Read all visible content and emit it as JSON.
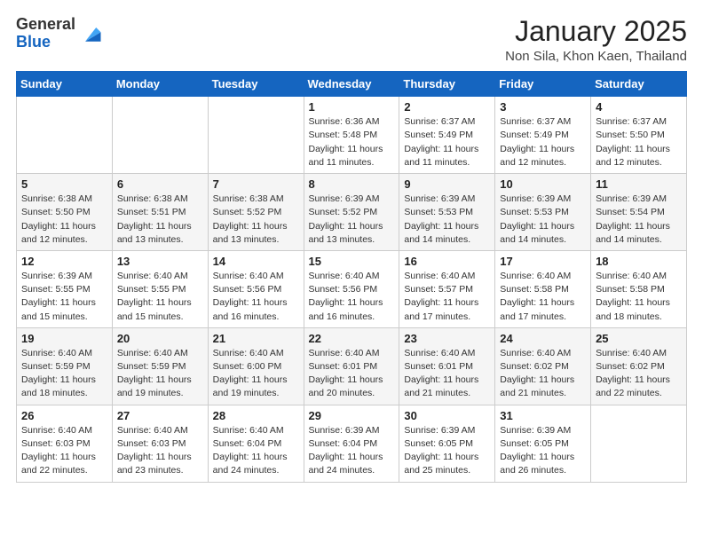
{
  "logo": {
    "general": "General",
    "blue": "Blue"
  },
  "header": {
    "month": "January 2025",
    "location": "Non Sila, Khon Kaen, Thailand"
  },
  "weekdays": [
    "Sunday",
    "Monday",
    "Tuesday",
    "Wednesday",
    "Thursday",
    "Friday",
    "Saturday"
  ],
  "weeks": [
    [
      {
        "day": "",
        "info": ""
      },
      {
        "day": "",
        "info": ""
      },
      {
        "day": "",
        "info": ""
      },
      {
        "day": "1",
        "info": "Sunrise: 6:36 AM\nSunset: 5:48 PM\nDaylight: 11 hours and 11 minutes."
      },
      {
        "day": "2",
        "info": "Sunrise: 6:37 AM\nSunset: 5:49 PM\nDaylight: 11 hours and 11 minutes."
      },
      {
        "day": "3",
        "info": "Sunrise: 6:37 AM\nSunset: 5:49 PM\nDaylight: 11 hours and 12 minutes."
      },
      {
        "day": "4",
        "info": "Sunrise: 6:37 AM\nSunset: 5:50 PM\nDaylight: 11 hours and 12 minutes."
      }
    ],
    [
      {
        "day": "5",
        "info": "Sunrise: 6:38 AM\nSunset: 5:50 PM\nDaylight: 11 hours and 12 minutes."
      },
      {
        "day": "6",
        "info": "Sunrise: 6:38 AM\nSunset: 5:51 PM\nDaylight: 11 hours and 13 minutes."
      },
      {
        "day": "7",
        "info": "Sunrise: 6:38 AM\nSunset: 5:52 PM\nDaylight: 11 hours and 13 minutes."
      },
      {
        "day": "8",
        "info": "Sunrise: 6:39 AM\nSunset: 5:52 PM\nDaylight: 11 hours and 13 minutes."
      },
      {
        "day": "9",
        "info": "Sunrise: 6:39 AM\nSunset: 5:53 PM\nDaylight: 11 hours and 14 minutes."
      },
      {
        "day": "10",
        "info": "Sunrise: 6:39 AM\nSunset: 5:53 PM\nDaylight: 11 hours and 14 minutes."
      },
      {
        "day": "11",
        "info": "Sunrise: 6:39 AM\nSunset: 5:54 PM\nDaylight: 11 hours and 14 minutes."
      }
    ],
    [
      {
        "day": "12",
        "info": "Sunrise: 6:39 AM\nSunset: 5:55 PM\nDaylight: 11 hours and 15 minutes."
      },
      {
        "day": "13",
        "info": "Sunrise: 6:40 AM\nSunset: 5:55 PM\nDaylight: 11 hours and 15 minutes."
      },
      {
        "day": "14",
        "info": "Sunrise: 6:40 AM\nSunset: 5:56 PM\nDaylight: 11 hours and 16 minutes."
      },
      {
        "day": "15",
        "info": "Sunrise: 6:40 AM\nSunset: 5:56 PM\nDaylight: 11 hours and 16 minutes."
      },
      {
        "day": "16",
        "info": "Sunrise: 6:40 AM\nSunset: 5:57 PM\nDaylight: 11 hours and 17 minutes."
      },
      {
        "day": "17",
        "info": "Sunrise: 6:40 AM\nSunset: 5:58 PM\nDaylight: 11 hours and 17 minutes."
      },
      {
        "day": "18",
        "info": "Sunrise: 6:40 AM\nSunset: 5:58 PM\nDaylight: 11 hours and 18 minutes."
      }
    ],
    [
      {
        "day": "19",
        "info": "Sunrise: 6:40 AM\nSunset: 5:59 PM\nDaylight: 11 hours and 18 minutes."
      },
      {
        "day": "20",
        "info": "Sunrise: 6:40 AM\nSunset: 5:59 PM\nDaylight: 11 hours and 19 minutes."
      },
      {
        "day": "21",
        "info": "Sunrise: 6:40 AM\nSunset: 6:00 PM\nDaylight: 11 hours and 19 minutes."
      },
      {
        "day": "22",
        "info": "Sunrise: 6:40 AM\nSunset: 6:01 PM\nDaylight: 11 hours and 20 minutes."
      },
      {
        "day": "23",
        "info": "Sunrise: 6:40 AM\nSunset: 6:01 PM\nDaylight: 11 hours and 21 minutes."
      },
      {
        "day": "24",
        "info": "Sunrise: 6:40 AM\nSunset: 6:02 PM\nDaylight: 11 hours and 21 minutes."
      },
      {
        "day": "25",
        "info": "Sunrise: 6:40 AM\nSunset: 6:02 PM\nDaylight: 11 hours and 22 minutes."
      }
    ],
    [
      {
        "day": "26",
        "info": "Sunrise: 6:40 AM\nSunset: 6:03 PM\nDaylight: 11 hours and 22 minutes."
      },
      {
        "day": "27",
        "info": "Sunrise: 6:40 AM\nSunset: 6:03 PM\nDaylight: 11 hours and 23 minutes."
      },
      {
        "day": "28",
        "info": "Sunrise: 6:40 AM\nSunset: 6:04 PM\nDaylight: 11 hours and 24 minutes."
      },
      {
        "day": "29",
        "info": "Sunrise: 6:39 AM\nSunset: 6:04 PM\nDaylight: 11 hours and 24 minutes."
      },
      {
        "day": "30",
        "info": "Sunrise: 6:39 AM\nSunset: 6:05 PM\nDaylight: 11 hours and 25 minutes."
      },
      {
        "day": "31",
        "info": "Sunrise: 6:39 AM\nSunset: 6:05 PM\nDaylight: 11 hours and 26 minutes."
      },
      {
        "day": "",
        "info": ""
      }
    ]
  ]
}
